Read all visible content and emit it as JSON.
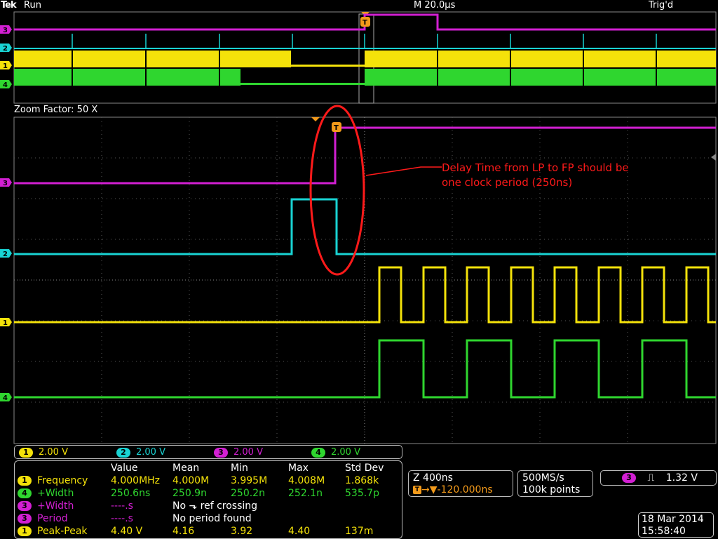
{
  "header": {
    "brand": "Tek",
    "run_state": "Run",
    "timebase": "M 20.0µs",
    "trigger_state": "Trig'd"
  },
  "zoom": {
    "label": "Zoom Factor: 50 X"
  },
  "channels": [
    {
      "id": "1",
      "color": "#f4e20a",
      "scale": "2.00 V"
    },
    {
      "id": "2",
      "color": "#19d3d3",
      "scale": "2.00 V"
    },
    {
      "id": "3",
      "color": "#d21fd2",
      "scale": "2.00 V"
    },
    {
      "id": "4",
      "color": "#2fd62f",
      "scale": "2.00 V"
    }
  ],
  "markers": {
    "trigger": "T"
  },
  "annotation": {
    "line1": "Delay Time from LP to FP should be",
    "line2": "one clock period (250ns)",
    "color": "#ff1a1a"
  },
  "measurements": {
    "headers": [
      "Value",
      "Mean",
      "Min",
      "Max",
      "Std Dev"
    ],
    "rows": [
      {
        "ch": "1",
        "name": "Frequency",
        "value": "4.000MHz",
        "mean": "4.000M",
        "min": "3.995M",
        "max": "4.008M",
        "std": "1.868k"
      },
      {
        "ch": "4",
        "name": "+Width",
        "value": "250.6ns",
        "mean": "250.9n",
        "min": "250.2n",
        "max": "252.1n",
        "std": "535.7p"
      },
      {
        "ch": "3",
        "name": "+Width",
        "value": "----.s",
        "note": "No ⬎ ref crossing"
      },
      {
        "ch": "3",
        "name": "Period",
        "value": "----.s",
        "note": "No period found"
      },
      {
        "ch": "1",
        "name": "Peak-Peak",
        "value": "4.40 V",
        "mean": "4.16",
        "min": "3.92",
        "max": "4.40",
        "std": "137m"
      }
    ]
  },
  "horizontal": {
    "zoom_scale": "Z 400ns",
    "position": "▼-120.000ns",
    "sample_rate": "500MS/s",
    "record_length": "100k points"
  },
  "trigger": {
    "source": "3",
    "slope_symbol": "⎍",
    "level": "1.32 V"
  },
  "datetime": {
    "date": "18 Mar 2014",
    "time": "15:58:40"
  }
}
